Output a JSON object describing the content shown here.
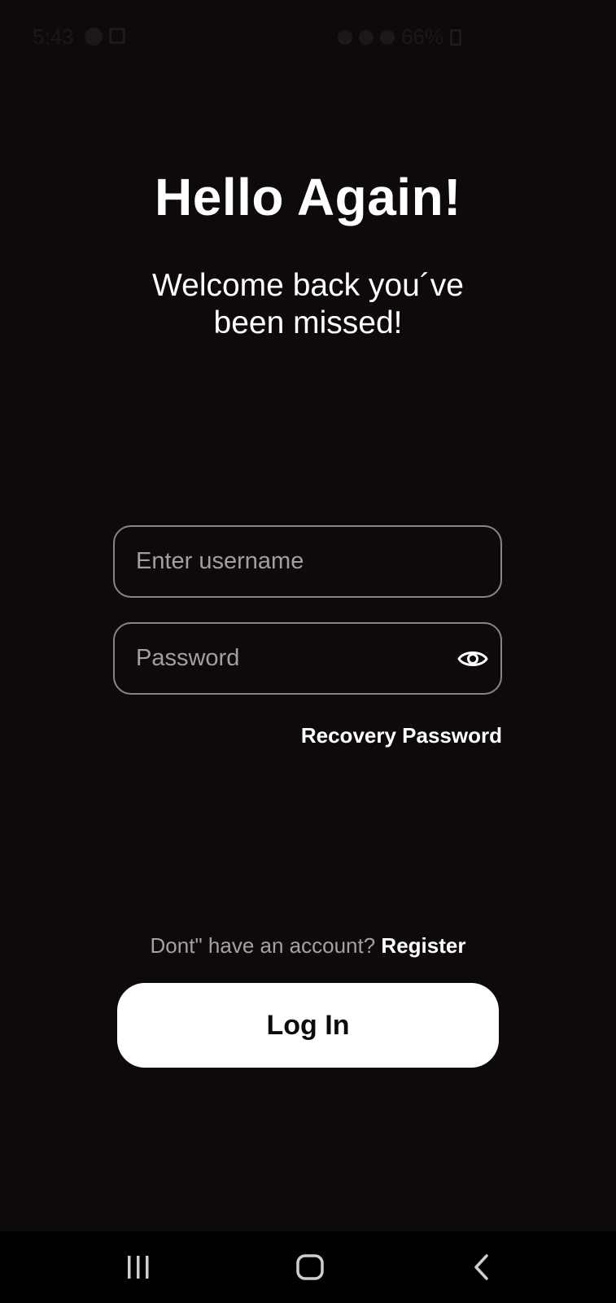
{
  "status_bar": {
    "time": "5:43",
    "battery": "66%"
  },
  "header": {
    "title": "Hello Again!",
    "subtitle_line1": "Welcome back you´ve",
    "subtitle_line2": "been missed!"
  },
  "form": {
    "username_placeholder": "Enter username",
    "username_value": "",
    "password_placeholder": "Password",
    "password_value": "",
    "password_toggle_icon": "eye-icon",
    "recovery_label": "Recovery Password"
  },
  "footer": {
    "register_prompt": "Dont\" have an account?",
    "register_label": "Register",
    "login_label": "Log In"
  },
  "nav": {
    "recents_icon": "recents-icon",
    "home_icon": "home-icon",
    "back_icon": "back-icon"
  },
  "colors": {
    "background": "#0e0a0c",
    "button_bg": "#ffffff",
    "field_border": "#8a8487",
    "muted_text": "#a6a0a3",
    "nav_bar": "#000000"
  }
}
